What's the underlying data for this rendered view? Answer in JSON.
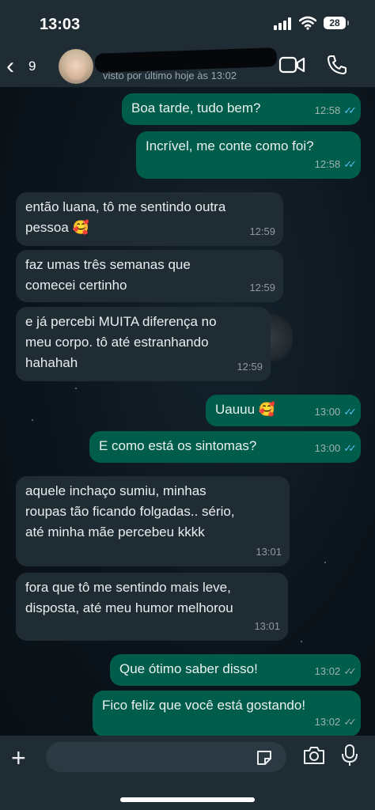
{
  "status_bar": {
    "time": "13:03",
    "battery": "28"
  },
  "header": {
    "back_count": "9",
    "last_seen": "visto por último hoje às 13:02"
  },
  "messages": [
    {
      "dir": "out",
      "text": "Boa tarde, tudo bem?",
      "time": "12:58",
      "read": true
    },
    {
      "dir": "out",
      "text": "Incrível, me conte como foi?",
      "time": "12:58",
      "read": true
    },
    {
      "dir": "in",
      "text": "então luana, tô me sentindo outra\npessoa 🥰",
      "time": "12:59"
    },
    {
      "dir": "in",
      "text": "faz umas três semanas que\ncomecei certinho",
      "time": "12:59"
    },
    {
      "dir": "in",
      "text": "e já percebi MUITA diferença no\nmeu corpo. tô até estranhando\nhahahah",
      "time": "12:59"
    },
    {
      "dir": "out",
      "text": "Uauuu 🥰",
      "time": "13:00",
      "read": true
    },
    {
      "dir": "out",
      "text": "E como está os sintomas?",
      "time": "13:00",
      "read": true
    },
    {
      "dir": "in",
      "text": "aquele inchaço sumiu, minhas\nroupas tão ficando folgadas.. sério,\naté minha mãe percebeu kkkk",
      "time": "13:01"
    },
    {
      "dir": "in",
      "text": "fora que tô me sentindo mais leve,\ndisposta, até meu humor melhorou",
      "time": "13:01"
    },
    {
      "dir": "out",
      "text": "Que ótimo saber disso!",
      "time": "13:02",
      "read": false
    },
    {
      "dir": "out",
      "text": "Fico feliz que você está gostando!",
      "time": "13:02",
      "read": false
    }
  ],
  "colors": {
    "outgoing_bubble": "#005c4b",
    "incoming_bubble": "#202c33",
    "read_ticks": "#53bdeb",
    "background": "#0b141a"
  }
}
